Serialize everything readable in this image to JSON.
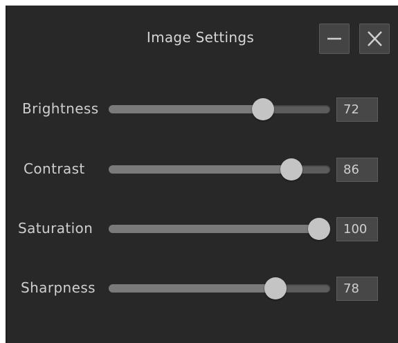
{
  "window": {
    "title": "Image Settings",
    "minimize_icon": "minimize-icon",
    "close_icon": "close-icon"
  },
  "settings": [
    {
      "label": "Brightness",
      "value": "72",
      "level": 72,
      "max": 100
    },
    {
      "label": "Contrast",
      "value": "86",
      "level": 86,
      "max": 100
    },
    {
      "label": "Saturation",
      "value": "100",
      "level": 100,
      "max": 100
    },
    {
      "label": "Sharpness",
      "value": "78",
      "level": 78,
      "max": 100
    }
  ],
  "colors": {
    "window_bg": "#282828",
    "text": "#cfcfcf",
    "track": "#5c5c5c",
    "thumb": "#c4c4c4"
  }
}
